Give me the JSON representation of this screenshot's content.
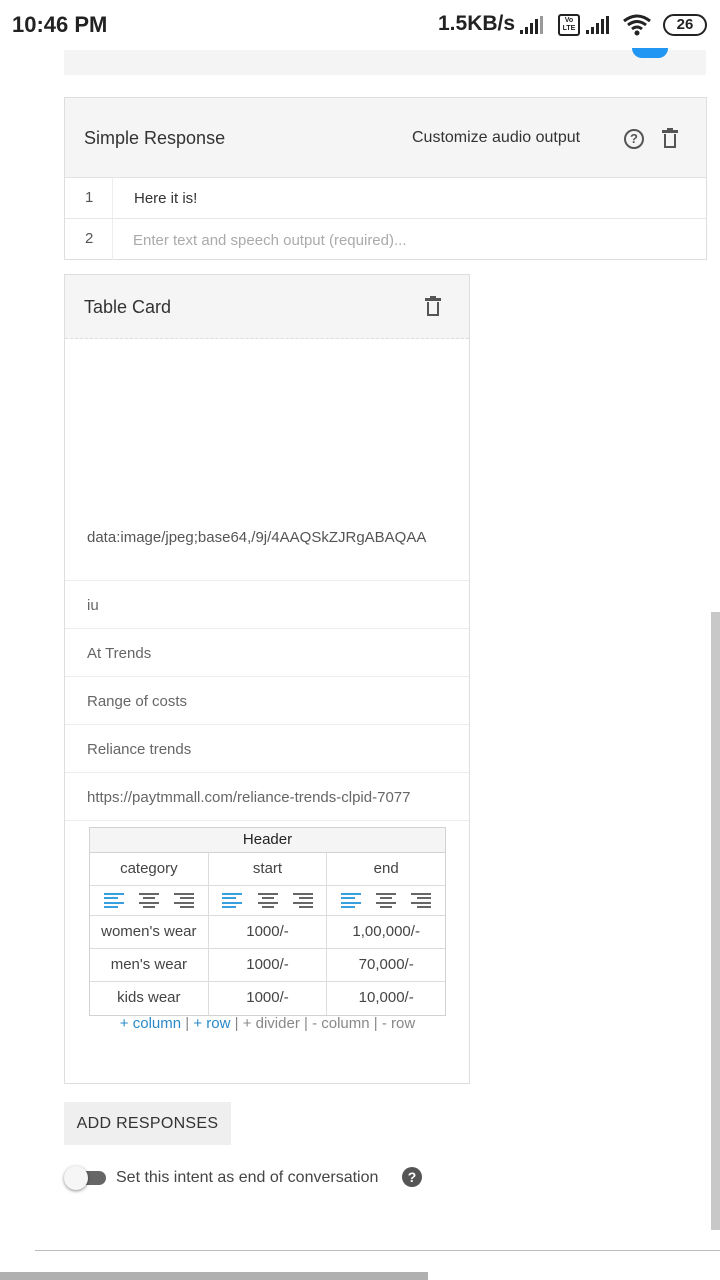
{
  "status_bar": {
    "time": "10:46 PM",
    "net_speed": "1.5KB/s",
    "volte": "Vo LTE",
    "battery": "26"
  },
  "simple_response": {
    "title": "Simple Response",
    "customize_label": "Customize audio output",
    "help_glyph": "?",
    "rows": [
      {
        "num": "1",
        "text": "Here it is!"
      },
      {
        "num": "2",
        "placeholder": "Enter text and speech output (required)..."
      }
    ]
  },
  "table_card": {
    "title": "Table Card",
    "image_url": "data:image/jpeg;base64,/9j/4AAQSkZJRgABAQAA",
    "fields": [
      "iu",
      "At Trends",
      "Range of costs",
      "Reliance trends",
      "https://paytmmall.com/reliance-trends-clpid-7077"
    ],
    "table": {
      "header": "Header",
      "columns": [
        "category",
        "start",
        "end"
      ],
      "rows": [
        [
          "women's wear",
          "1000/-",
          "1,00,000/-"
        ],
        [
          "men's wear",
          "1000/-",
          "70,000/-"
        ],
        [
          "kids wear",
          "1000/-",
          "10,000/-"
        ]
      ],
      "actions": {
        "add_column": "+ column",
        "add_row": "+ row",
        "add_divider": "+ divider",
        "remove_column": "- column",
        "remove_row": "- row",
        "sep": "|"
      }
    }
  },
  "add_responses_label": "ADD RESPONSES",
  "end_conversation": {
    "label": "Set this intent as end of conversation",
    "enabled": false,
    "help_glyph": "?"
  },
  "colors": {
    "accent_blue": "#2196f3",
    "link_blue": "#2a8ac9",
    "active_align": "#39a0e0"
  }
}
